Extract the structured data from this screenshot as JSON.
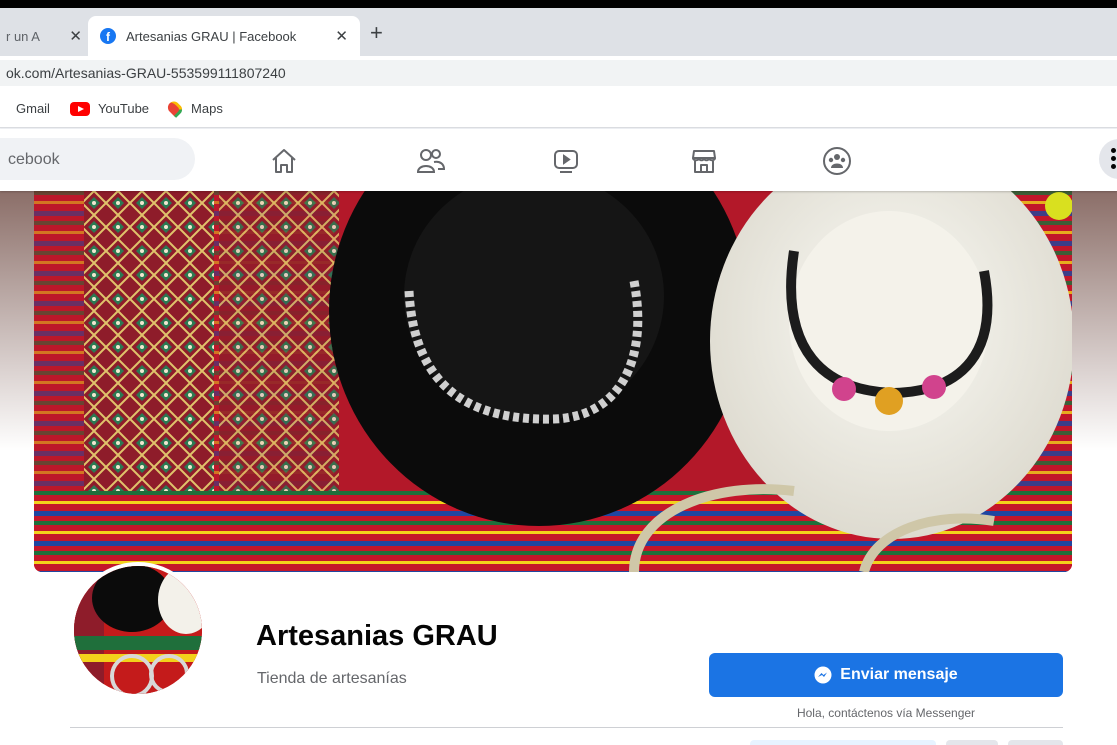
{
  "browser": {
    "tabs": [
      {
        "title": "r un A",
        "active": false
      },
      {
        "title": "Artesanias GRAU | Facebook",
        "active": true
      }
    ],
    "tab_close": "✕",
    "new_tab": "+",
    "url": "ok.com/Artesanias-GRAU-553599111807240",
    "bookmarks": [
      {
        "label": "Gmail",
        "icon": "gmail-icon"
      },
      {
        "label": "YouTube",
        "icon": "youtube-icon"
      },
      {
        "label": "Maps",
        "icon": "maps-icon"
      }
    ]
  },
  "facebook_header": {
    "search_placeholder": "cebook",
    "nav_icons": [
      "home-icon",
      "friends-icon",
      "watch-icon",
      "marketplace-icon",
      "groups-icon"
    ],
    "menu_icon": "menu-dots-icon"
  },
  "page": {
    "name": "Artesanias GRAU",
    "category": "Tienda de artesanías",
    "message_button": "Enviar mensaje",
    "message_caption": "Hola, contáctenos vía Messenger"
  },
  "colors": {
    "facebook_blue": "#1877f2",
    "button_blue": "#1b74e4",
    "cover_red": "#b31829"
  }
}
